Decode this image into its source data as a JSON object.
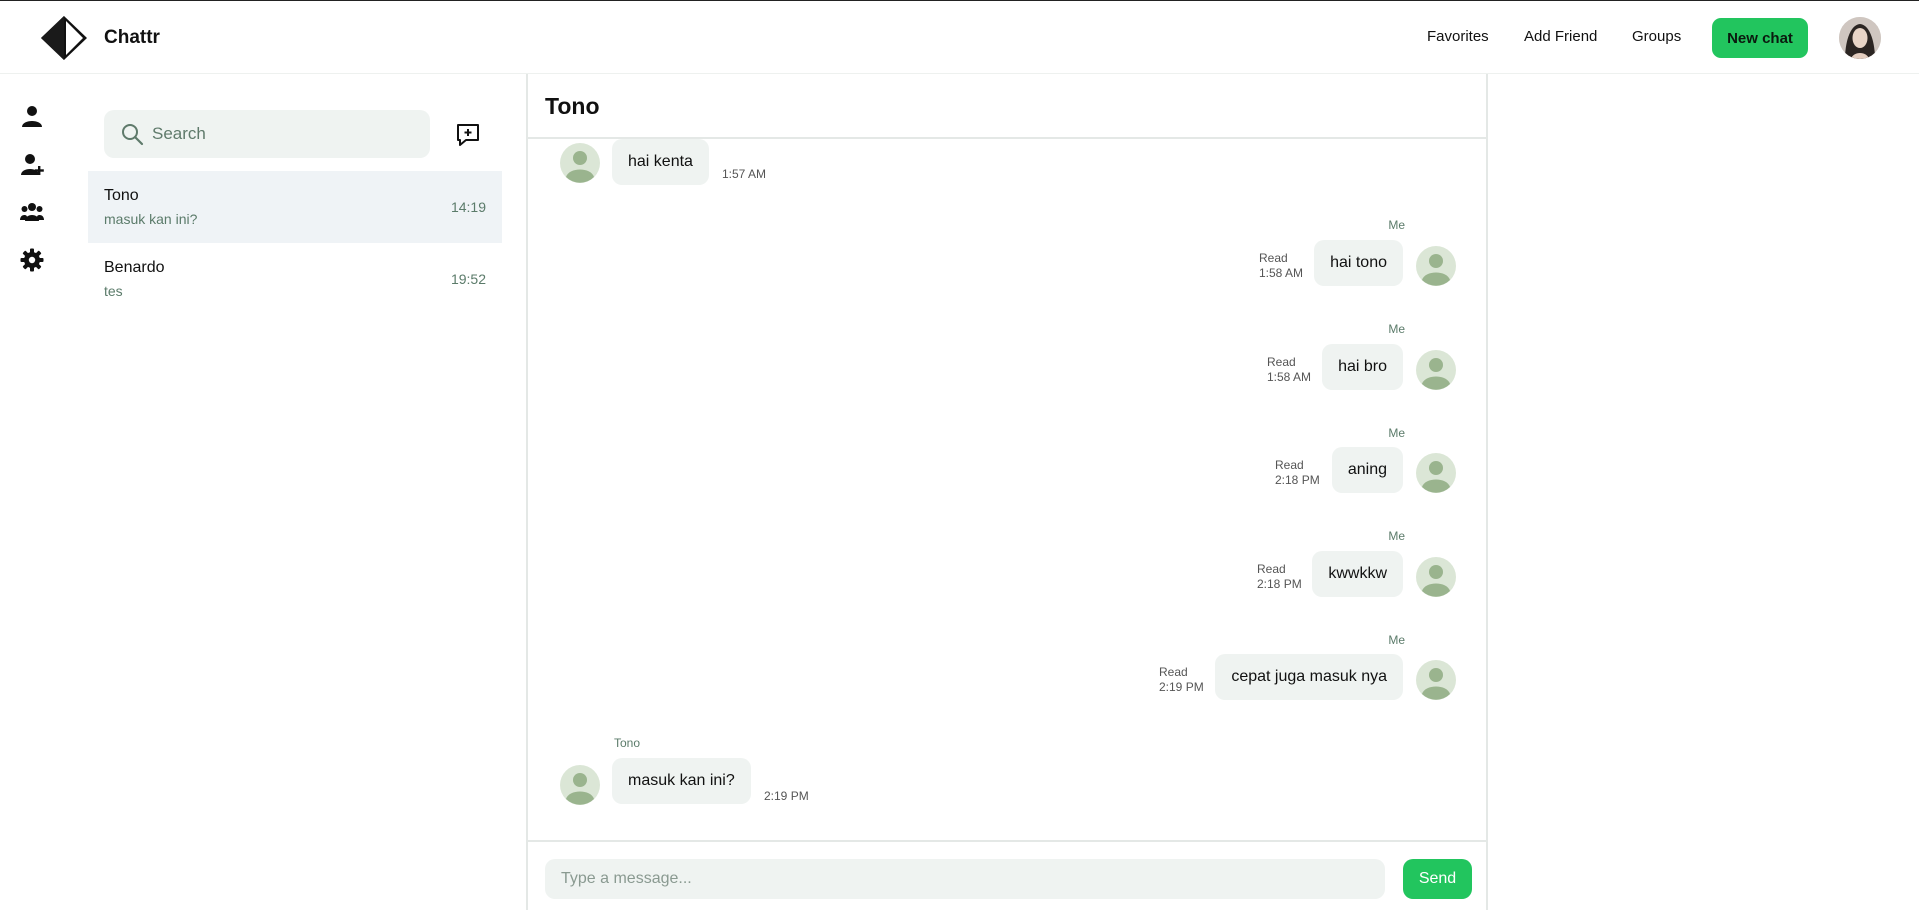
{
  "app": {
    "brand": "Chattr"
  },
  "nav": {
    "favorites": "Favorites",
    "add_friend": "Add Friend",
    "groups": "Groups",
    "new_chat": "New chat"
  },
  "sidebar": {
    "icons": [
      "user-icon",
      "add-user-icon",
      "group-icon",
      "settings-icon"
    ]
  },
  "search": {
    "placeholder": "Search"
  },
  "conversations": [
    {
      "name": "Tono",
      "preview": "masuk kan ini?",
      "time": "14:19",
      "active": true
    },
    {
      "name": "Benardo",
      "preview": "tes",
      "time": "19:52",
      "active": false
    }
  ],
  "chat": {
    "title": "Tono",
    "messages": [
      {
        "from": "them",
        "sender": "",
        "text": "hai kenta",
        "time": "1:57 AM"
      },
      {
        "from": "me",
        "sender": "Me",
        "status": "Read",
        "text": "hai tono",
        "time": "1:58 AM"
      },
      {
        "from": "me",
        "sender": "Me",
        "status": "Read",
        "text": "hai bro",
        "time": "1:58 AM"
      },
      {
        "from": "me",
        "sender": "Me",
        "status": "Read",
        "text": "aning",
        "time": "2:18 PM"
      },
      {
        "from": "me",
        "sender": "Me",
        "status": "Read",
        "text": "kwwkkw",
        "time": "2:18 PM"
      },
      {
        "from": "me",
        "sender": "Me",
        "status": "Read",
        "text": "cepat juga masuk nya",
        "time": "2:19 PM"
      },
      {
        "from": "them",
        "sender": "Tono",
        "text": "masuk kan ini?",
        "time": "2:19 PM"
      }
    ],
    "input_placeholder": "Type a message...",
    "send_label": "Send"
  },
  "colors": {
    "accent": "#22c55e",
    "bubble": "#eff3f1",
    "muted": "#5b7b6a"
  }
}
